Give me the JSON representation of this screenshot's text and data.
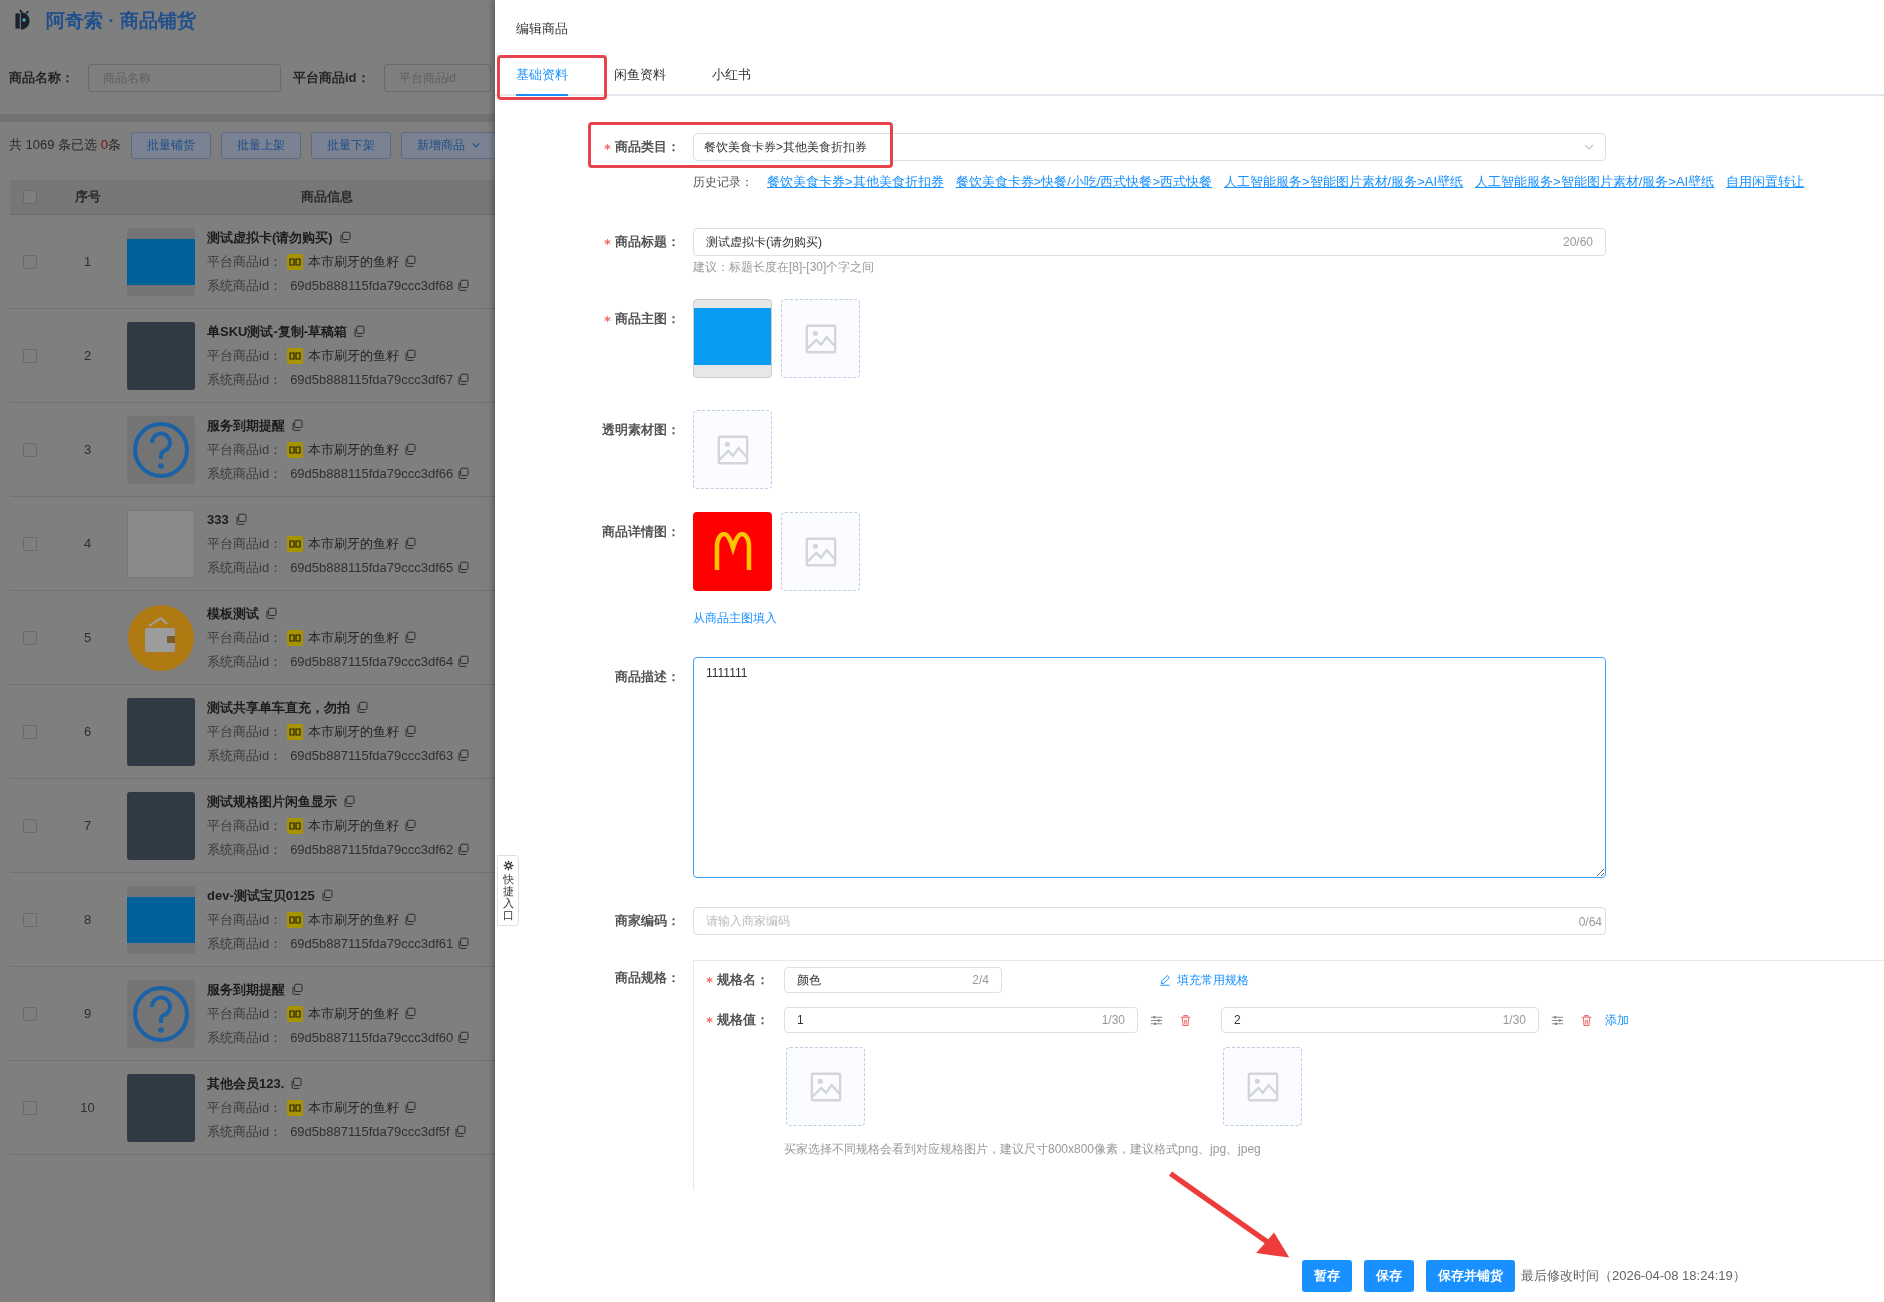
{
  "app": {
    "title": "阿奇索 · 商品铺货"
  },
  "filters": [
    {
      "label": "商品名称：",
      "placeholder": "商品名称"
    },
    {
      "label": "平台商品id：",
      "placeholder": "平台商品id"
    }
  ],
  "toolbar": {
    "summary_prefix": "共 1069 条已选 ",
    "selected_count": "0",
    "summary_suffix": "条",
    "buttons": [
      {
        "label": "批量铺货",
        "dropdown": false
      },
      {
        "label": "批量上架",
        "dropdown": false
      },
      {
        "label": "批量下架",
        "dropdown": false
      },
      {
        "label": "新增商品",
        "dropdown": true
      }
    ]
  },
  "table": {
    "columns": [
      "序号",
      "商品信息"
    ],
    "header_checked": false,
    "rows": [
      {
        "index": "1",
        "checked": false,
        "kind": "banner",
        "title": "测试虚拟卡(请勿购买)",
        "platform_label": "平台商品id：",
        "shop": "本市刷牙的鱼籽",
        "system_label": "系统商品id：",
        "system_id": "69d5b888115fda79ccc3df68"
      },
      {
        "index": "2",
        "checked": false,
        "kind": "photo",
        "title": "单SKU测试-复制-草稿箱",
        "platform_label": "平台商品id：",
        "shop": "本市刷牙的鱼籽",
        "system_label": "系统商品id：",
        "system_id": "69d5b888115fda79ccc3df67"
      },
      {
        "index": "3",
        "checked": false,
        "kind": "help",
        "title": "服务到期提醒",
        "platform_label": "平台商品id：",
        "shop": "本市刷牙的鱼籽",
        "system_label": "系统商品id：",
        "system_id": "69d5b888115fda79ccc3df66"
      },
      {
        "index": "4",
        "checked": false,
        "kind": "document",
        "title": "333",
        "platform_label": "平台商品id：",
        "shop": "本市刷牙的鱼籽",
        "system_label": "系统商品id：",
        "system_id": "69d5b888115fda79ccc3df65"
      },
      {
        "index": "5",
        "checked": false,
        "kind": "wallet",
        "title": "模板测试",
        "platform_label": "平台商品id：",
        "shop": "本市刷牙的鱼籽",
        "system_label": "系统商品id：",
        "system_id": "69d5b887115fda79ccc3df64"
      },
      {
        "index": "6",
        "checked": false,
        "kind": "photo",
        "title": "测试共享单车直充，勿拍",
        "platform_label": "平台商品id：",
        "shop": "本市刷牙的鱼籽",
        "system_label": "系统商品id：",
        "system_id": "69d5b887115fda79ccc3df63"
      },
      {
        "index": "7",
        "checked": false,
        "kind": "photo",
        "title": "测试规格图片闲鱼显示",
        "platform_label": "平台商品id：",
        "shop": "本市刷牙的鱼籽",
        "system_label": "系统商品id：",
        "system_id": "69d5b887115fda79ccc3df62"
      },
      {
        "index": "8",
        "checked": false,
        "kind": "banner",
        "title": "dev-测试宝贝0125",
        "platform_label": "平台商品id：",
        "shop": "本市刷牙的鱼籽",
        "system_label": "系统商品id：",
        "system_id": "69d5b887115fda79ccc3df61"
      },
      {
        "index": "9",
        "checked": false,
        "kind": "help",
        "title": "服务到期提醒",
        "platform_label": "平台商品id：",
        "shop": "本市刷牙的鱼籽",
        "system_label": "系统商品id：",
        "system_id": "69d5b887115fda79ccc3df60"
      },
      {
        "index": "10",
        "checked": false,
        "kind": "photo",
        "title": "其他会员123.",
        "platform_label": "平台商品id：",
        "shop": "本市刷牙的鱼籽",
        "system_label": "系统商品id：",
        "system_id": "69d5b887115fda79ccc3df5f"
      }
    ]
  },
  "drawer": {
    "title": "编辑商品",
    "tabs": [
      {
        "label": "基础资料",
        "selected": true
      },
      {
        "label": "闲鱼资料",
        "selected": false
      },
      {
        "label": "小红书",
        "selected": false
      }
    ],
    "category": {
      "label": "商品类目：",
      "required": true,
      "value": "餐饮美食卡券>其他美食折扣券"
    },
    "history": {
      "label": "历史记录：",
      "links": [
        "餐饮美食卡券>其他美食折扣券",
        "餐饮美食卡券>快餐/小吃/西式快餐>西式快餐",
        "人工智能服务>智能图片素材/服务>AI壁纸",
        "人工智能服务>智能图片素材/服务>AI壁纸",
        "自用闲置转让"
      ]
    },
    "product_title": {
      "label": "商品标题：",
      "required": true,
      "value": "测试虚拟卡(请勿购买)",
      "count": "20/60",
      "hint": "建议：标题长度在[8]-[30]个字之间"
    },
    "main_images": {
      "label": "商品主图：",
      "required": true,
      "images": [
        {
          "kind": "banner"
        }
      ]
    },
    "transparent_images": {
      "label": "透明素材图：",
      "required": false
    },
    "detail_images": {
      "label": "商品详情图：",
      "required": false,
      "images": [
        {
          "kind": "logo"
        }
      ],
      "link": "从商品主图填入"
    },
    "description": {
      "label": "商品描述：",
      "required": false,
      "value": "1111111",
      "focused": true
    },
    "merchant_code": {
      "label": "商家编码：",
      "required": false,
      "placeholder": "请输入商家编码",
      "count": "0/64"
    },
    "specs": {
      "label": "商品规格：",
      "name_label": "规格名：",
      "name_value": "颜色",
      "name_count": "2/4",
      "fill_link": "填充常用规格",
      "values_label": "规格值：",
      "values": [
        {
          "value": "1",
          "count": "1/30"
        },
        {
          "value": "2",
          "count": "1/30"
        }
      ],
      "add_link": "添加",
      "hint": "买家选择不同规格会看到对应规格图片，建议尺寸800x800像素，建议格式png、jpg、jpeg"
    },
    "footer": {
      "buttons": [
        "暂存",
        "保存",
        "保存并铺货"
      ],
      "last_modified": "最后修改时间（2026-04-08 18:24:19）"
    },
    "quick_entry": {
      "label": "快捷入口"
    }
  }
}
